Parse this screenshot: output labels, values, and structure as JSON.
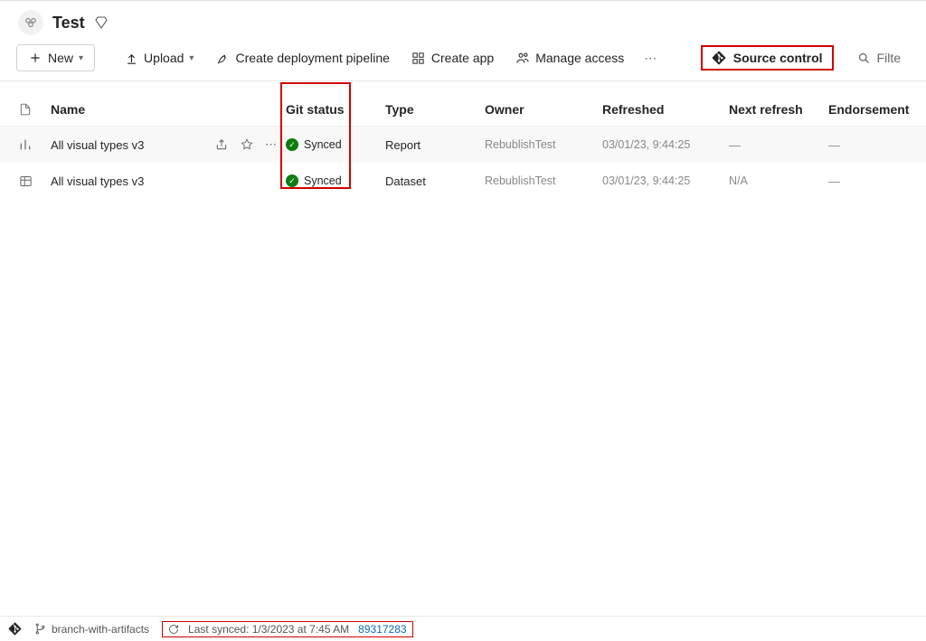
{
  "workspace": {
    "title": "Test"
  },
  "toolbar": {
    "new": "New",
    "upload": "Upload",
    "pipeline": "Create deployment pipeline",
    "create_app": "Create app",
    "manage_access": "Manage access",
    "source_control": "Source control",
    "filter": "Filte"
  },
  "columns": {
    "name": "Name",
    "git": "Git status",
    "type": "Type",
    "owner": "Owner",
    "refreshed": "Refreshed",
    "next": "Next refresh",
    "endorsement": "Endorsement"
  },
  "rows": [
    {
      "name": "All visual types v3",
      "git": "Synced",
      "type": "Report",
      "owner": "RebublishTest",
      "refreshed": "03/01/23, 9:44:25",
      "next": "—",
      "endorsement": "—"
    },
    {
      "name": "All visual types v3",
      "git": "Synced",
      "type": "Dataset",
      "owner": "RebublishTest",
      "refreshed": "03/01/23, 9:44:25",
      "next": "N/A",
      "endorsement": "—"
    }
  ],
  "status": {
    "branch": "branch-with-artifacts",
    "last_synced": "Last synced: 1/3/2023 at 7:45 AM",
    "commit": "89317283"
  }
}
